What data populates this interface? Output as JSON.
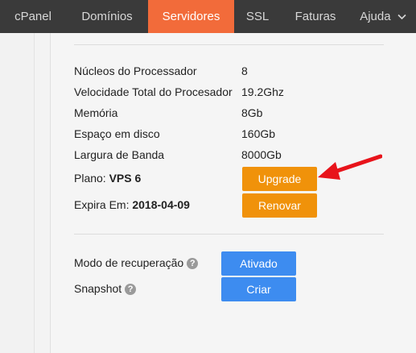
{
  "nav": {
    "items": [
      {
        "label": "cPanel"
      },
      {
        "label": "Domínios"
      },
      {
        "label": "Servidores"
      },
      {
        "label": "SSL"
      },
      {
        "label": "Faturas"
      },
      {
        "label": "Ajuda"
      }
    ],
    "active": "Servidores"
  },
  "server": {
    "rows": [
      {
        "label": "Núcleos do Processador",
        "value": "8"
      },
      {
        "label": "Velocidade Total do Procesador",
        "value": "19.2Ghz"
      },
      {
        "label": "Memória",
        "value": "8Gb"
      },
      {
        "label": "Espaço em disco",
        "value": "160Gb"
      },
      {
        "label": "Largura de Banda",
        "value": "8000Gb"
      }
    ],
    "plan_label": "Plano:",
    "plan_value": "VPS 6",
    "expires_label": "Expira Em:",
    "expires_value": "2018-04-09",
    "upgrade_button": "Upgrade",
    "renew_button": "Renovar"
  },
  "recovery": {
    "label": "Modo de recuperação",
    "button": "Ativado"
  },
  "snapshot": {
    "label": "Snapshot",
    "button": "Criar"
  },
  "colors": {
    "nav_bg": "#3a3a3a",
    "nav_active": "#f26b3a",
    "orange_button": "#f0920a",
    "blue_button": "#3d8cf0",
    "annotation_arrow": "#e8141b"
  },
  "icons": {
    "help": "question-circle-icon",
    "dropdown": "chevron-down-icon",
    "annotation": "red-arrow-annotation"
  }
}
